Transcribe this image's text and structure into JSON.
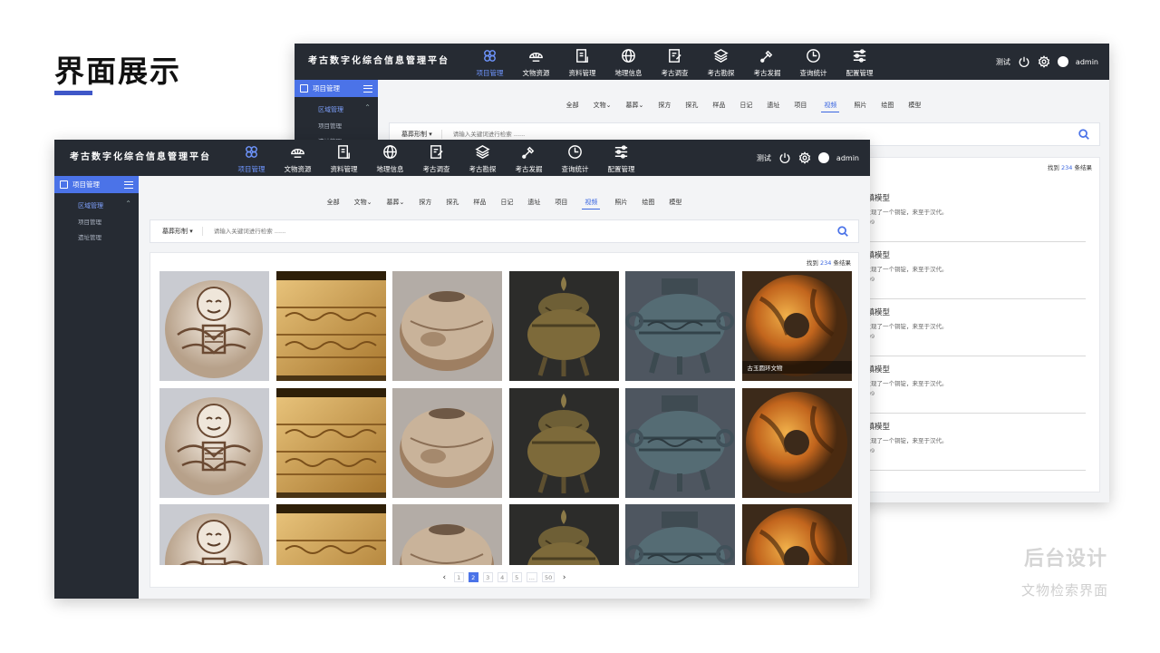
{
  "slide": {
    "title": "界面展示",
    "watermark_title": "后台设计",
    "watermark_subtitle": "文物检索界面"
  },
  "app": {
    "brand": "考古数字化综合信息管理平台",
    "nav": [
      {
        "label": "项目管理",
        "icon": "project-icon",
        "active": true
      },
      {
        "label": "文物资源",
        "icon": "artifact-icon",
        "active": false
      },
      {
        "label": "资料管理",
        "icon": "document-icon",
        "active": false
      },
      {
        "label": "地理信息",
        "icon": "globe-icon",
        "active": false
      },
      {
        "label": "考古调查",
        "icon": "survey-icon",
        "active": false
      },
      {
        "label": "考古勘探",
        "icon": "layers-icon",
        "active": false
      },
      {
        "label": "考古发掘",
        "icon": "shovel-icon",
        "active": false
      },
      {
        "label": "查询统计",
        "icon": "clock-icon",
        "active": false
      },
      {
        "label": "配置管理",
        "icon": "sliders-icon",
        "active": false
      }
    ],
    "header_right": {
      "test": "测试",
      "user": "admin"
    },
    "sidebar": {
      "head": "项目管理",
      "group": "区域管理",
      "items": [
        "项目管理",
        "遗址管理"
      ]
    },
    "filter_tabs": [
      "全部",
      "文物",
      "墓葬",
      "探方",
      "探孔",
      "样品",
      "日记",
      "遗址",
      "项目",
      "视频",
      "照片",
      "绘图",
      "模型"
    ],
    "filter_dropdown_tabs": [
      "文物",
      "墓葬"
    ],
    "active_tab": "视频",
    "search": {
      "select": "墓葬形制",
      "placeholder": "请输入关键词进行检索 ......"
    },
    "results_count": {
      "prefix": "找到",
      "n": "234",
      "suffix": "条结果"
    },
    "back_results": [
      {
        "title": "…镇模型",
        "desc": "…发现了一个铜锭，来至于汉代。",
        "date": "…-09"
      },
      {
        "title": "…镇模型",
        "desc": "…发现了一个铜锭，来至于汉代。",
        "date": "…-09"
      },
      {
        "title": "…镇模型",
        "desc": "…发现了一个铜锭，来至于汉代。",
        "date": "…-09"
      },
      {
        "title": "…镇模型",
        "desc": "…发现了一个铜锭，来至于汉代。",
        "date": "…-09"
      },
      {
        "title": "…镇模型",
        "desc": "…发现了一个铜锭，来至于汉代。",
        "date": "…-09"
      }
    ],
    "grid": {
      "columns": [
        "jade-figure",
        "carved-stone",
        "clay-jar",
        "bronze-censer",
        "bronze-vessel",
        "jade-disc"
      ],
      "rows": 3,
      "hover_caption": "古玉圆环文物"
    },
    "pagination": [
      "1",
      "2",
      "3",
      "4",
      "5",
      "...",
      "50"
    ],
    "current_page": "2"
  },
  "colors": {
    "header": "#262b33",
    "accent": "#4b73e8",
    "content_bg": "#f3f4f6"
  }
}
